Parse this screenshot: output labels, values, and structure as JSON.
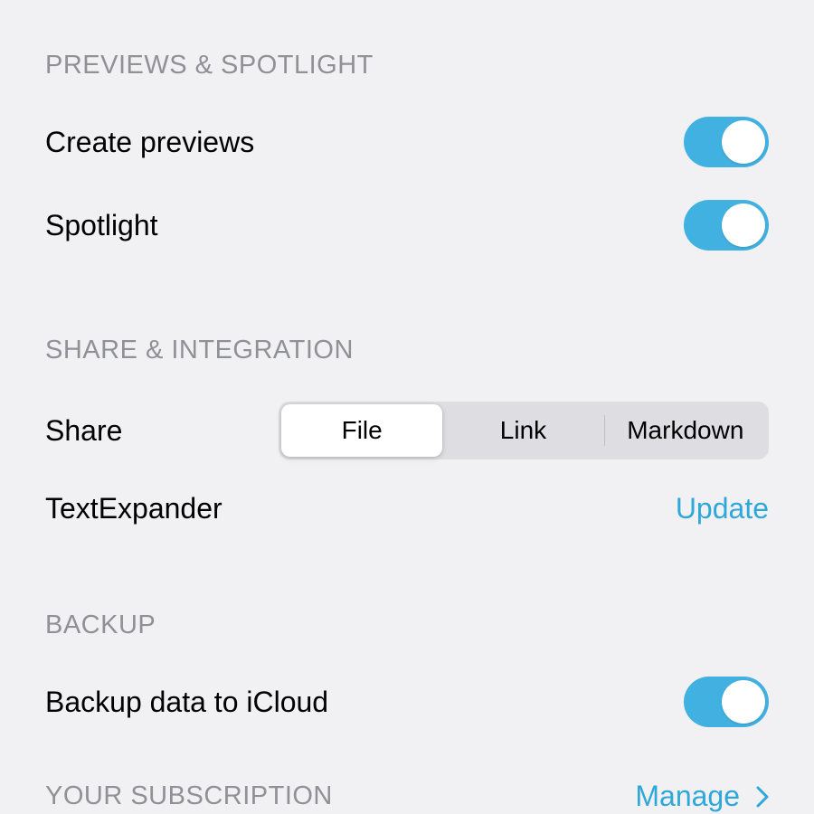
{
  "sections": {
    "previews": {
      "header": "PREVIEWS & SPOTLIGHT",
      "create_previews_label": "Create previews",
      "spotlight_label": "Spotlight",
      "create_previews_on": true,
      "spotlight_on": true
    },
    "share": {
      "header": "SHARE & INTEGRATION",
      "share_label": "Share",
      "segments": {
        "file": "File",
        "link": "Link",
        "markdown": "Markdown"
      },
      "selected_segment": "File",
      "textexpander_label": "TextExpander",
      "textexpander_action": "Update"
    },
    "backup": {
      "header": "BACKUP",
      "backup_label": "Backup data to iCloud",
      "backup_on": true
    },
    "subscription": {
      "header": "YOUR SUBSCRIPTION",
      "action": "Manage"
    }
  }
}
